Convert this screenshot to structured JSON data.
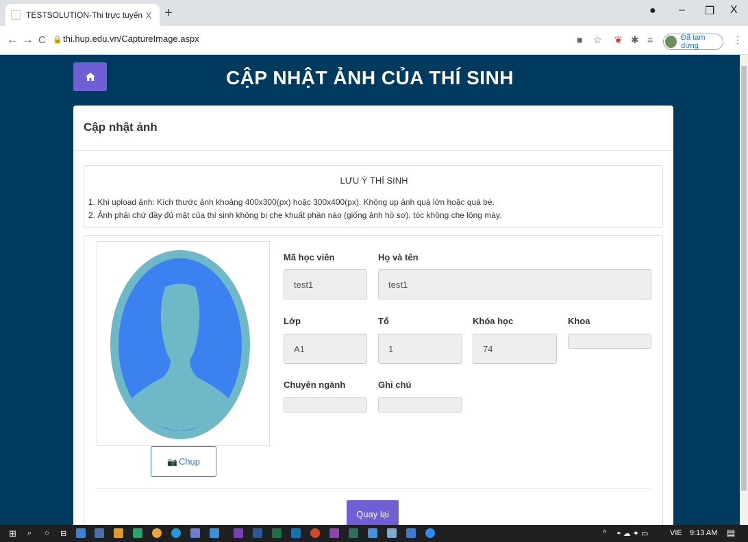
{
  "browser": {
    "tab_title": "TESTSOLUTION-Thi trực tuyến",
    "tab_close": "X",
    "new_tab": "+",
    "url": "thi.hup.edu.vn/CaptureImage.aspx",
    "profile_status": "Đã tạm dừng",
    "window_controls": {
      "minimize": "–",
      "restore": "❐",
      "close": "X"
    },
    "nav": {
      "back": "←",
      "forward": "→",
      "reload": "C"
    }
  },
  "page": {
    "title": "CẬP NHẬT ẢNH CỦA THÍ SINH",
    "home_icon": "home-icon",
    "card_title": "Cập nhật ảnh",
    "notice": {
      "title": "LƯU Ý THÍ SINH",
      "line1": "1. Khi upload ảnh: Kích thước ảnh khoảng 400x300(px) hoặc 300x400(px). Không up ảnh quá lớn hoặc quá bé.",
      "line2": "2. Ảnh phải chứ đầy đủ mặt của thí sinh không bị che khuất phần nào (giống ảnh hồ sơ), tóc không che lông mày."
    },
    "capture_button": "Chụp",
    "fields": {
      "student_id": {
        "label": "Mã học viên",
        "value": "test1"
      },
      "full_name": {
        "label": "Họ và tên",
        "value": "test1"
      },
      "class": {
        "label": "Lớp",
        "value": "A1"
      },
      "group": {
        "label": "Tổ",
        "value": "1"
      },
      "course": {
        "label": "Khóa học",
        "value": "74"
      },
      "faculty": {
        "label": "Khoa",
        "value": ""
      },
      "major": {
        "label": "Chuyên ngành",
        "value": ""
      },
      "note": {
        "label": "Ghi chú",
        "value": ""
      }
    },
    "back_button": "Quay lại"
  },
  "taskbar": {
    "language": "VIE",
    "time": "9:13 AM"
  },
  "colors": {
    "page_bg": "#003a5f",
    "accent": "#6f5fd4",
    "avatar_ring": "#6fb8c8",
    "avatar_fill": "#3b82f0"
  }
}
